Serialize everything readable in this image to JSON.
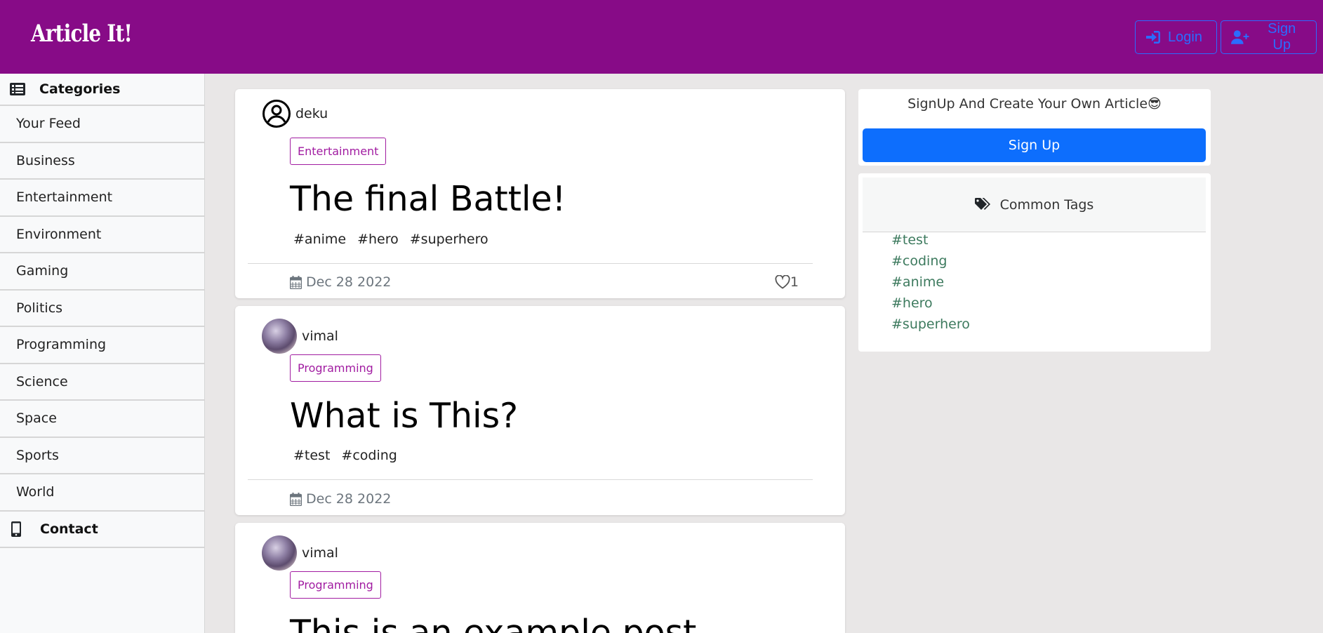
{
  "header": {
    "brand": "Article It!",
    "login_label": "Login",
    "signup_label": "Sign Up"
  },
  "sidebar": {
    "categories_label": "Categories",
    "items": [
      {
        "label": "Your Feed"
      },
      {
        "label": "Business"
      },
      {
        "label": "Entertainment"
      },
      {
        "label": "Environment"
      },
      {
        "label": "Gaming"
      },
      {
        "label": "Politics"
      },
      {
        "label": "Programming"
      },
      {
        "label": "Science"
      },
      {
        "label": "Space"
      },
      {
        "label": "Sports"
      },
      {
        "label": "World"
      }
    ],
    "contact_label": "Contact"
  },
  "posts": [
    {
      "author": "deku",
      "category": "Entertainment",
      "title": "The final Battle!",
      "tags": [
        "#anime",
        "#hero",
        "#superhero"
      ],
      "date": "Dec 28 2022",
      "likes": "1"
    },
    {
      "author": "vimal",
      "category": "Programming",
      "title": "What is This?",
      "tags": [
        "#test",
        "#coding"
      ],
      "date": "Dec 28 2022"
    },
    {
      "author": "vimal",
      "category": "Programming",
      "title": "This is an example post"
    }
  ],
  "signup_widget": {
    "text": "SignUp And Create Your Own Article😎",
    "button_label": "Sign Up"
  },
  "common_tags": {
    "title": "Common Tags",
    "tags": [
      "#test",
      "#coding",
      "#anime",
      "#hero",
      "#superhero"
    ]
  },
  "colors": {
    "header_bg": "#870b87",
    "accent_blue": "#0d6efd",
    "badge_purple": "#a11ca1",
    "tag_green": "#3d7a5e"
  }
}
